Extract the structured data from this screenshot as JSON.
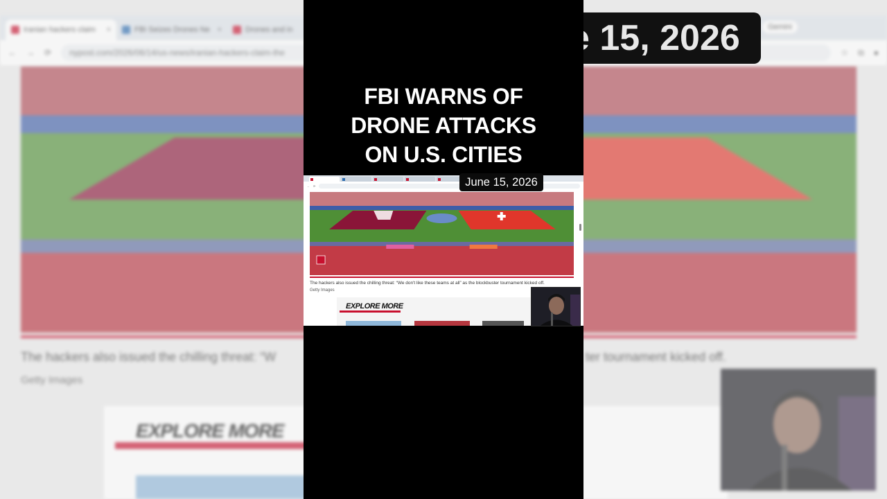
{
  "overlay": {
    "headline_lines": [
      "FBI WARNS OF",
      "DRONE ATTACKS",
      "ON U.S. CITIES"
    ],
    "date_badge": "June 15, 2026",
    "background_date": "e 15, 2026"
  },
  "browser": {
    "tabs": [
      {
        "label": "Iranian hackers claim",
        "icon": "nypost-favicon"
      },
      {
        "label": "FBI Seizes Drones Ne",
        "icon": "news-favicon"
      },
      {
        "label": "Drones and in",
        "icon": "red-favicon"
      }
    ],
    "url": "nypost.com/2026/06/14/us-news/iranian-hackers-claim-the",
    "gemini_label": "Gemini"
  },
  "article": {
    "caption_left": "The hackers also issued the chilling threat: “W",
    "caption_right": "ter tournament kicked off.",
    "caption_full": "The hackers also issued the chilling threat: “We don't like these teams at all” as the blockbuster tournament kicked off.",
    "credit": "Getty Images",
    "explore_more": "EXPLORE MORE",
    "photo_badge": "5"
  },
  "colors": {
    "accent_red": "#c8102e",
    "pitch_green": "#4f8f36",
    "qatar_maroon": "#8a1538",
    "swiss_red": "#e0362b"
  }
}
